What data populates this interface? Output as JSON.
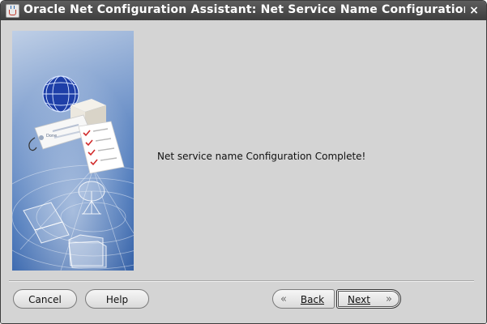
{
  "window": {
    "title": "Oracle Net Configuration Assistant: Net Service Name Configuration Do",
    "close_glyph": "×"
  },
  "main": {
    "message": "Net service name Configuration Complete!"
  },
  "sidebar_image": {
    "label_text": "Done"
  },
  "buttons": {
    "cancel": "Cancel",
    "help": "Help",
    "back": "Back",
    "next": "Next",
    "back_chevron": "«",
    "next_chevron": "»"
  },
  "colors": {
    "titlebar": "#4a4a4a",
    "background": "#d4d4d4",
    "image_blue": "#3f6fb6"
  }
}
